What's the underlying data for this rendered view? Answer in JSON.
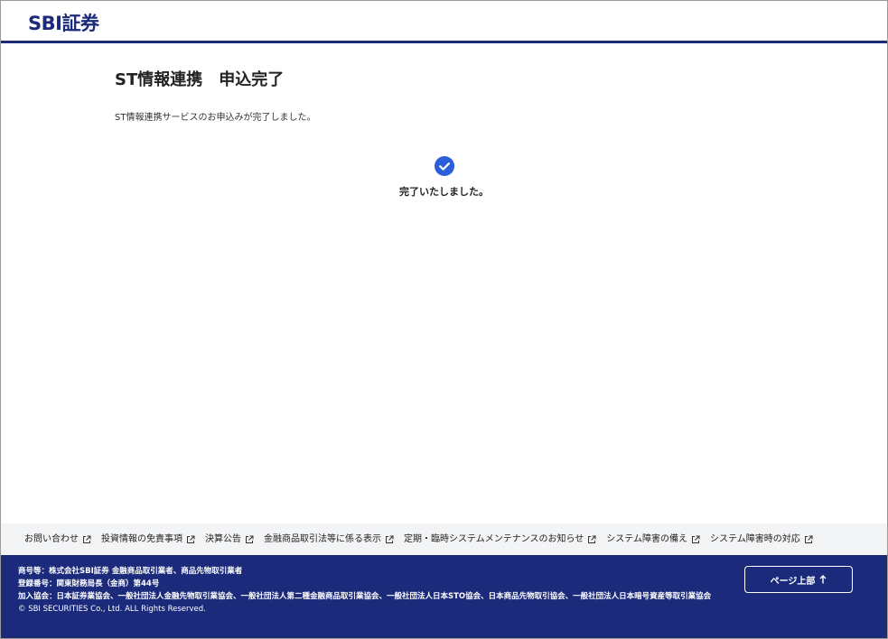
{
  "header": {
    "logo_text": "SBI証券"
  },
  "main": {
    "title": "ST情報連携　申込完了",
    "message": "ST情報連携サービスのお申込みが完了しました。",
    "complete_text": "完了いたしました。"
  },
  "footer_links": [
    {
      "label": "お問い合わせ"
    },
    {
      "label": "投資情報の免責事項"
    },
    {
      "label": "決算公告"
    },
    {
      "label": "金融商品取引法等に係る表示"
    },
    {
      "label": "定期・臨時システムメンテナンスのお知らせ"
    },
    {
      "label": "システム障害の備え"
    },
    {
      "label": "システム障害時の対応"
    }
  ],
  "footer": {
    "line1": "商号等：株式会社SBI証券 金融商品取引業者、商品先物取引業者",
    "line2": "登録番号：関東財務局長（金商）第44号",
    "line3": "加入協会：日本証券業協会、一般社団法人金融先物取引業協会、一般社団法人第二種金融商品取引業協会、一般社団法人日本STO協会、日本商品先物取引協会、一般社団法人日本暗号資産等取引業協会",
    "copyright": "© SBI SECURITIES Co., Ltd. ALL Rights Reserved.",
    "page_top_label": "ページ上部"
  },
  "colors": {
    "brand": "#1b2a7a",
    "check": "#2b5fd9",
    "footer_links_bg": "#f3f4f6"
  },
  "icons": {
    "complete": "check-circle-icon",
    "external": "external-link-icon",
    "page_top": "arrow-up-icon"
  }
}
